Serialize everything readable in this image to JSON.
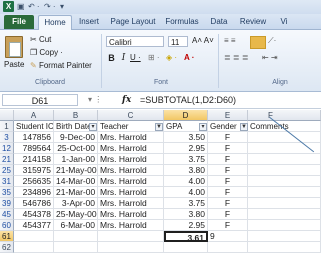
{
  "qat": {
    "undo": "↶ ·",
    "redo": "↷ ·",
    "more": "▾"
  },
  "tabs": [
    "File",
    "Home",
    "Insert",
    "Page Layout",
    "Formulas",
    "Data",
    "Review",
    "Vi"
  ],
  "active_tab": "Home",
  "ribbon": {
    "clipboard": {
      "paste": "Paste",
      "cut": "Cut",
      "copy": "Copy ·",
      "format_painter": "Format Painter",
      "label": "Clipboard"
    },
    "font": {
      "name": "Calibri",
      "size": "11",
      "label": "Font",
      "bold": "B",
      "italic": "I",
      "underline": "U ·"
    },
    "alignment": {
      "label": "Align"
    }
  },
  "formula_bar": {
    "name_box": "D61",
    "fx": "fx",
    "formula": "=SUBTOTAL(1,D2:D60)"
  },
  "columns": [
    "A",
    "B",
    "C",
    "D",
    "E",
    "F"
  ],
  "header_row": {
    "row": "1",
    "cells": [
      "Student IC",
      "Birth Date",
      "Teacher",
      "GPA",
      "Gender",
      "Comments"
    ]
  },
  "rows": [
    {
      "row": "3",
      "id": "147856",
      "date": "9-Dec-00",
      "teacher": "Mrs. Harrold",
      "gpa": "3.50",
      "gender": "F"
    },
    {
      "row": "12",
      "id": "789564",
      "date": "25-Oct-00",
      "teacher": "Mrs. Harrold",
      "gpa": "2.95",
      "gender": "F"
    },
    {
      "row": "21",
      "id": "214158",
      "date": "1-Jan-00",
      "teacher": "Mrs. Harrold",
      "gpa": "3.75",
      "gender": "F"
    },
    {
      "row": "25",
      "id": "315975",
      "date": "21-May-00",
      "teacher": "Mrs. Harrold",
      "gpa": "3.80",
      "gender": "F"
    },
    {
      "row": "31",
      "id": "256635",
      "date": "14-Mar-00",
      "teacher": "Mrs. Harrold",
      "gpa": "4.00",
      "gender": "F"
    },
    {
      "row": "35",
      "id": "234896",
      "date": "21-Mar-00",
      "teacher": "Mrs. Harrold",
      "gpa": "4.00",
      "gender": "F"
    },
    {
      "row": "39",
      "id": "546786",
      "date": "3-Apr-00",
      "teacher": "Mrs. Harrold",
      "gpa": "3.75",
      "gender": "F"
    },
    {
      "row": "45",
      "id": "454378",
      "date": "25-May-00",
      "teacher": "Mrs. Harrold",
      "gpa": "3.80",
      "gender": "F"
    },
    {
      "row": "60",
      "id": "454377",
      "date": "6-Mar-00",
      "teacher": "Mrs. Harrold",
      "gpa": "2.95",
      "gender": "F"
    }
  ],
  "total_row": {
    "row": "61",
    "gpa": "3.61",
    "gender": "9"
  },
  "last_row": {
    "row": "62"
  }
}
